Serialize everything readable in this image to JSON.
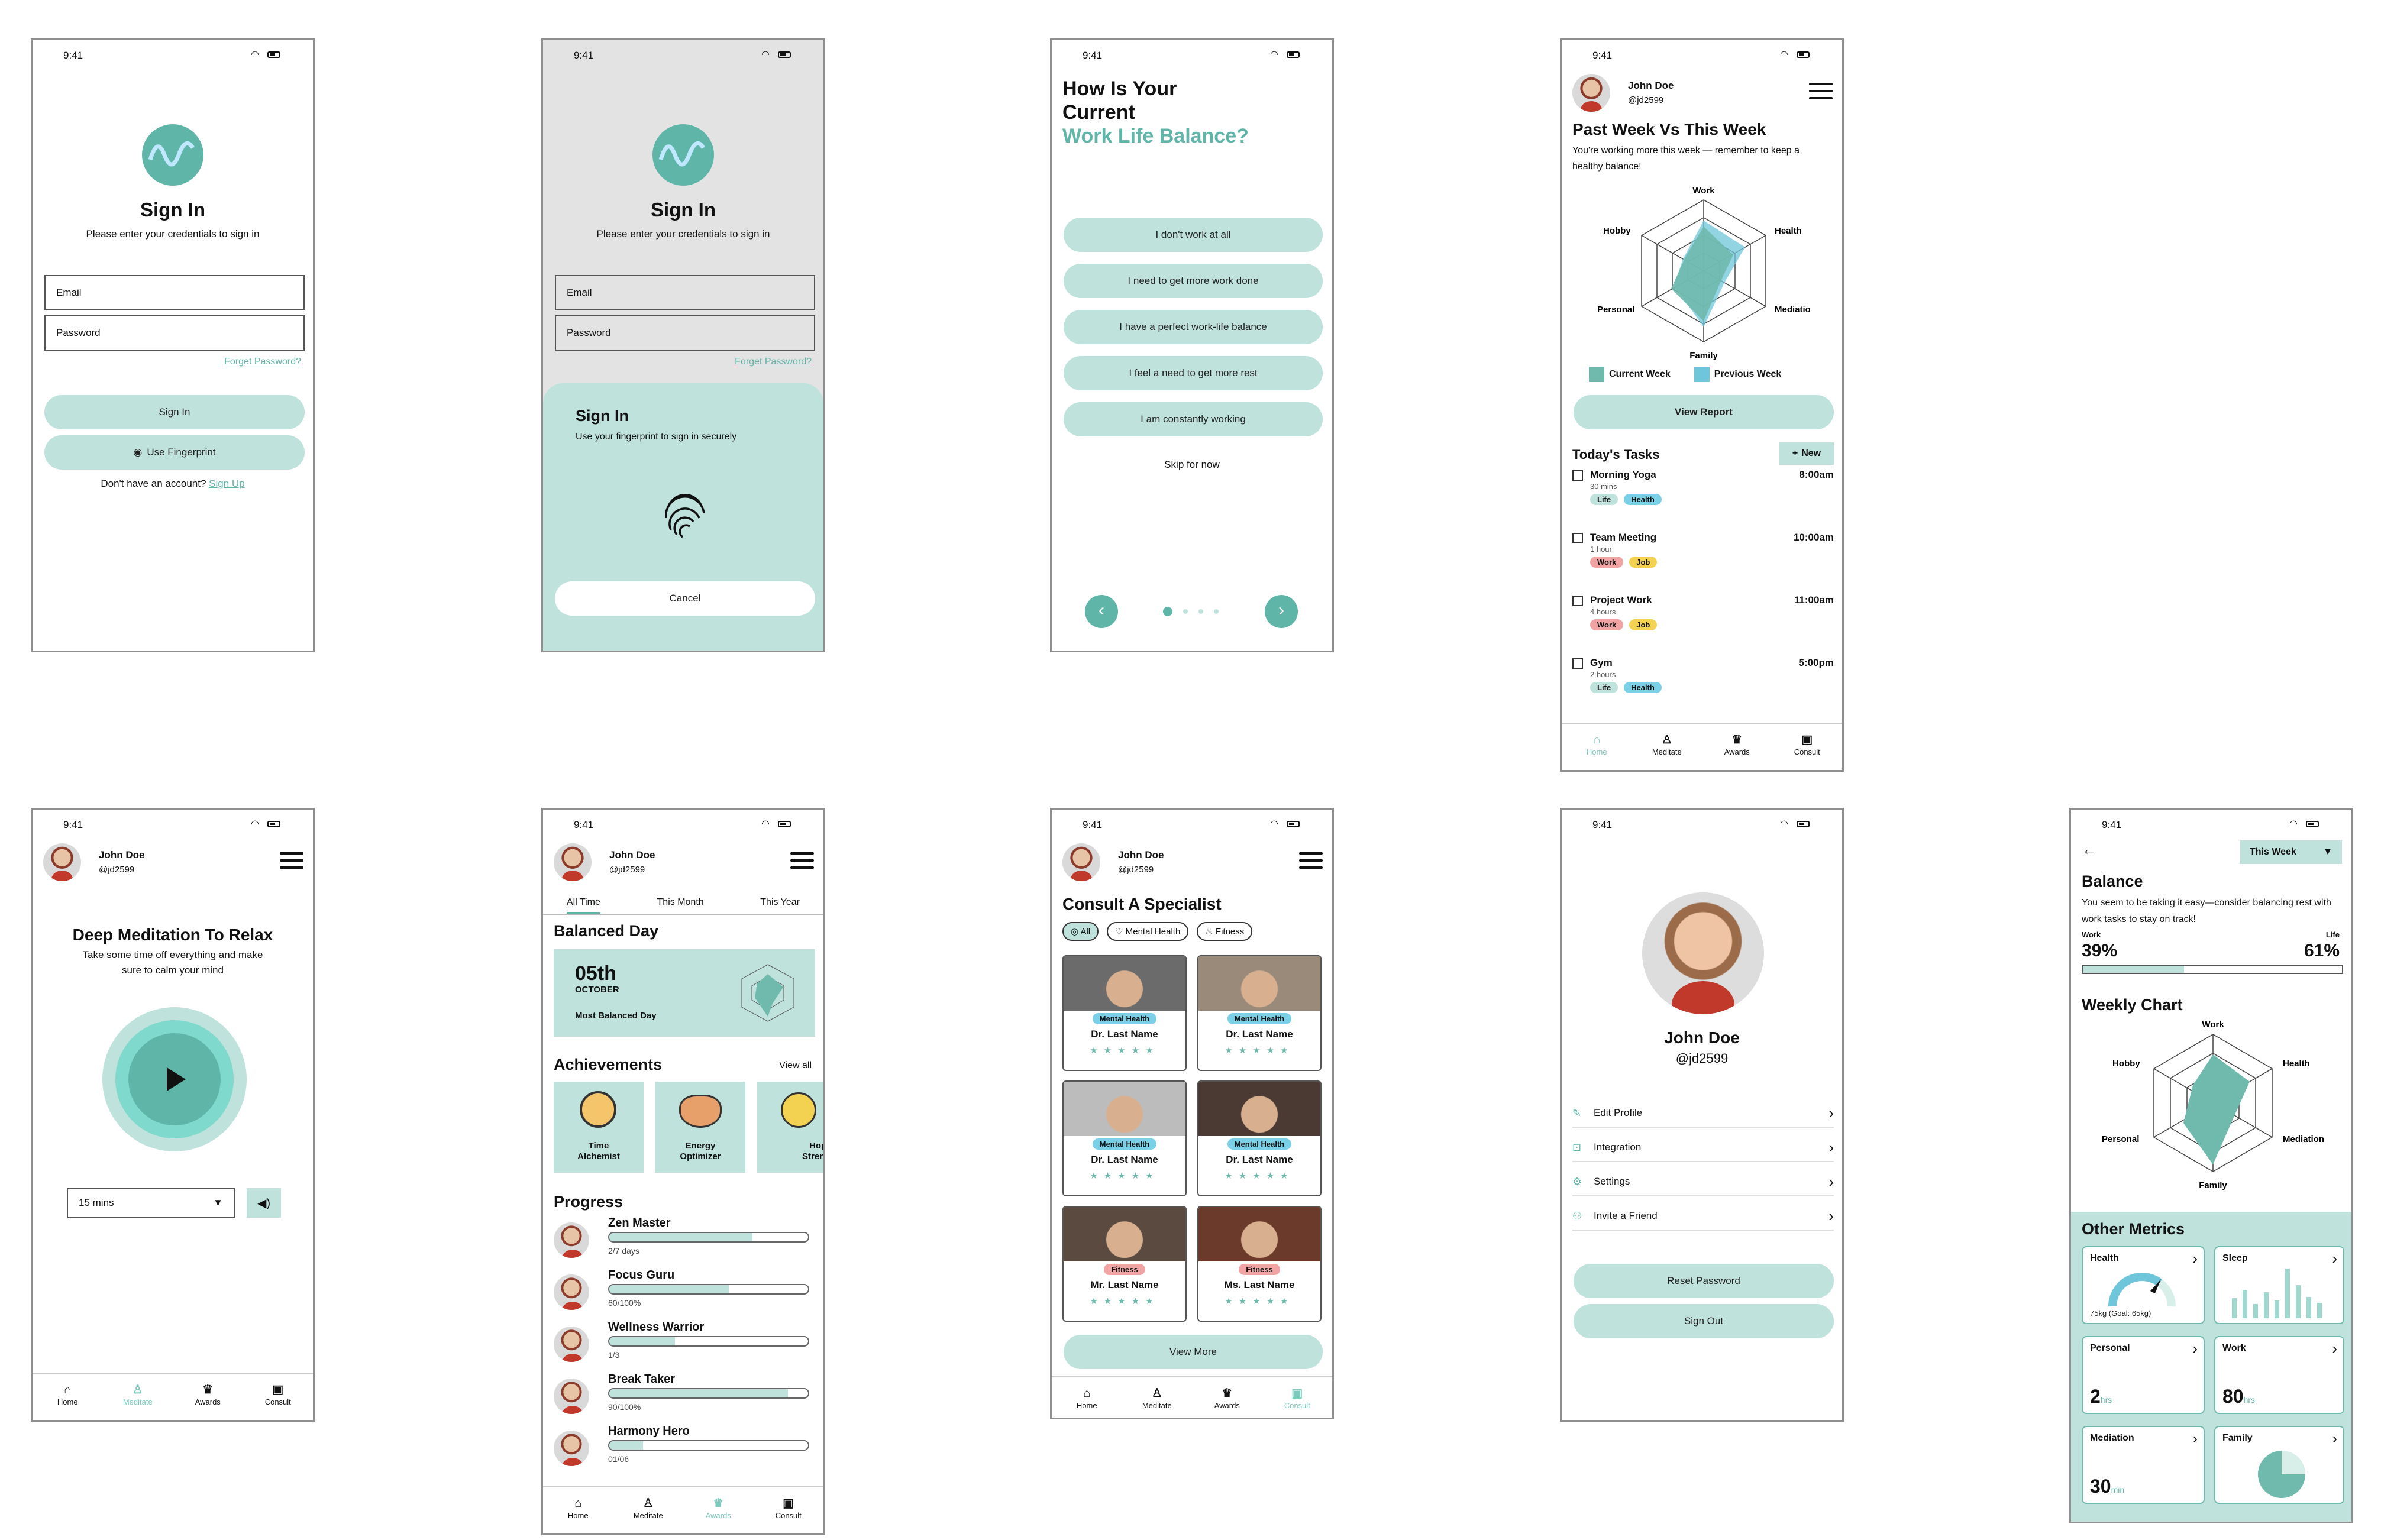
{
  "status_time": "9:41",
  "s1": {
    "title": "Sign In",
    "subtitle": "Please enter your credentials to sign in",
    "email": "Email",
    "password": "Password",
    "forgot": "Forget Password?",
    "signin": "Sign In",
    "fingerprint": "Use Fingerprint",
    "no_account": "Don't have an account?",
    "signup": "Sign Up"
  },
  "s2": {
    "title": "Sign In",
    "subtitle": "Please enter your credentials to sign in",
    "email": "Email",
    "password": "Password",
    "forgot": "Forget Password?",
    "sheet_title": "Sign In",
    "sheet_sub": "Use your fingerprint to sign in securely",
    "cancel": "Cancel"
  },
  "s3": {
    "q1": "How Is Your",
    "q2": "Current",
    "q3": "Work Life Balance?",
    "options": [
      "I don't work at all",
      "I need to get more work done",
      "I have a perfect work-life balance",
      "I feel a need to get more rest",
      "I am constantly working"
    ],
    "skip": "Skip for now"
  },
  "user": {
    "name": "John Doe",
    "handle": "@jd2599"
  },
  "s4": {
    "title": "Past Week Vs This Week",
    "subtitle": "You're working more this week — remember to keep a healthy balance!",
    "radar_labels": [
      "Work",
      "Health",
      "Mediation",
      "Family",
      "Personal",
      "Hobby"
    ],
    "legend_current": "Current Week",
    "legend_previous": "Previous Week",
    "view_report": "View Report",
    "tasks_title": "Today's Tasks",
    "new": "New",
    "tasks": [
      {
        "name": "Morning Yoga",
        "dur": "30 mins",
        "time": "8:00am",
        "tags": [
          "Life",
          "Health"
        ]
      },
      {
        "name": "Team Meeting",
        "dur": "1 hour",
        "time": "10:00am",
        "tags": [
          "Work",
          "Job"
        ]
      },
      {
        "name": "Project Work",
        "dur": "4 hours",
        "time": "11:00am",
        "tags": [
          "Work",
          "Job"
        ]
      },
      {
        "name": "Gym",
        "dur": "2 hours",
        "time": "5:00pm",
        "tags": [
          "Life",
          "Health"
        ]
      }
    ]
  },
  "nav": [
    "Home",
    "Meditate",
    "Awards",
    "Consult"
  ],
  "s5": {
    "title": "Deep Meditation To Relax",
    "sub1": "Take some time off everything and make",
    "sub2": "sure to calm your mind",
    "duration": "15 mins"
  },
  "s6": {
    "tabs": [
      "All Time",
      "This Month",
      "This Year"
    ],
    "title": "Balanced Day",
    "day": "05th",
    "month": "OCTOBER",
    "most": "Most Balanced Day",
    "ach_title": "Achievements",
    "view_all": "View all",
    "achievements": [
      [
        "Time",
        "Alchemist"
      ],
      [
        "Energy",
        "Optimizer"
      ],
      [
        "Hope",
        "Strength"
      ]
    ],
    "progress_title": "Progress",
    "progress": [
      {
        "name": "Zen Master",
        "value": "2/7 days",
        "pct": 0.72
      },
      {
        "name": "Focus Guru",
        "value": "60/100%",
        "pct": 0.6
      },
      {
        "name": "Wellness Warrior",
        "value": "1/3",
        "pct": 0.33
      },
      {
        "name": "Break Taker",
        "value": "90/100%",
        "pct": 0.9
      },
      {
        "name": "Harmony Hero",
        "value": "01/06",
        "pct": 0.17
      }
    ]
  },
  "s7": {
    "title": "Consult A Specialist",
    "filters": [
      "All",
      "Mental Health",
      "Fitness"
    ],
    "doctors": [
      {
        "tag": "Mental Health",
        "name": "Dr. Last Name"
      },
      {
        "tag": "Mental Health",
        "name": "Dr. Last Name"
      },
      {
        "tag": "Mental Health",
        "name": "Dr. Last Name"
      },
      {
        "tag": "Mental Health",
        "name": "Dr. Last Name"
      },
      {
        "tag": "Fitness",
        "name": "Mr. Last Name"
      },
      {
        "tag": "Fitness",
        "name": "Ms. Last Name"
      }
    ],
    "stars": "★★★★★",
    "view_more": "View More"
  },
  "s8": {
    "name": "John Doe",
    "handle": "@jd2599",
    "menu": [
      "Edit Profile",
      "Integration",
      "Settings",
      "Invite a Friend"
    ],
    "reset": "Reset Password",
    "signout": "Sign Out"
  },
  "s9": {
    "week": "This Week",
    "title": "Balance",
    "desc": "You seem to be taking it easy—consider balancing rest with work tasks to stay on track!",
    "work": "Work",
    "life": "Life",
    "work_pct": "39%",
    "life_pct": "61%",
    "balance_work_fraction": 0.39,
    "weekly": "Weekly Chart",
    "radar_labels": [
      "Work",
      "Health",
      "Mediation",
      "Family",
      "Personal",
      "Hobby"
    ],
    "other": "Other Metrics",
    "metrics": {
      "health": "Health",
      "health_val": "75kg (Goal: 65kg)",
      "sleep": "Sleep",
      "personal": "Personal",
      "personal_n": "2",
      "personal_u": "hrs",
      "work": "Work",
      "work_n": "80",
      "work_u": "hrs",
      "mediation": "Mediation",
      "mediation_n": "30",
      "mediation_u": "min",
      "family": "Family"
    }
  },
  "colors": {
    "accent": "#5fb5a8",
    "mint": "#bfe3dc",
    "cyan": "#7ad0e6"
  }
}
